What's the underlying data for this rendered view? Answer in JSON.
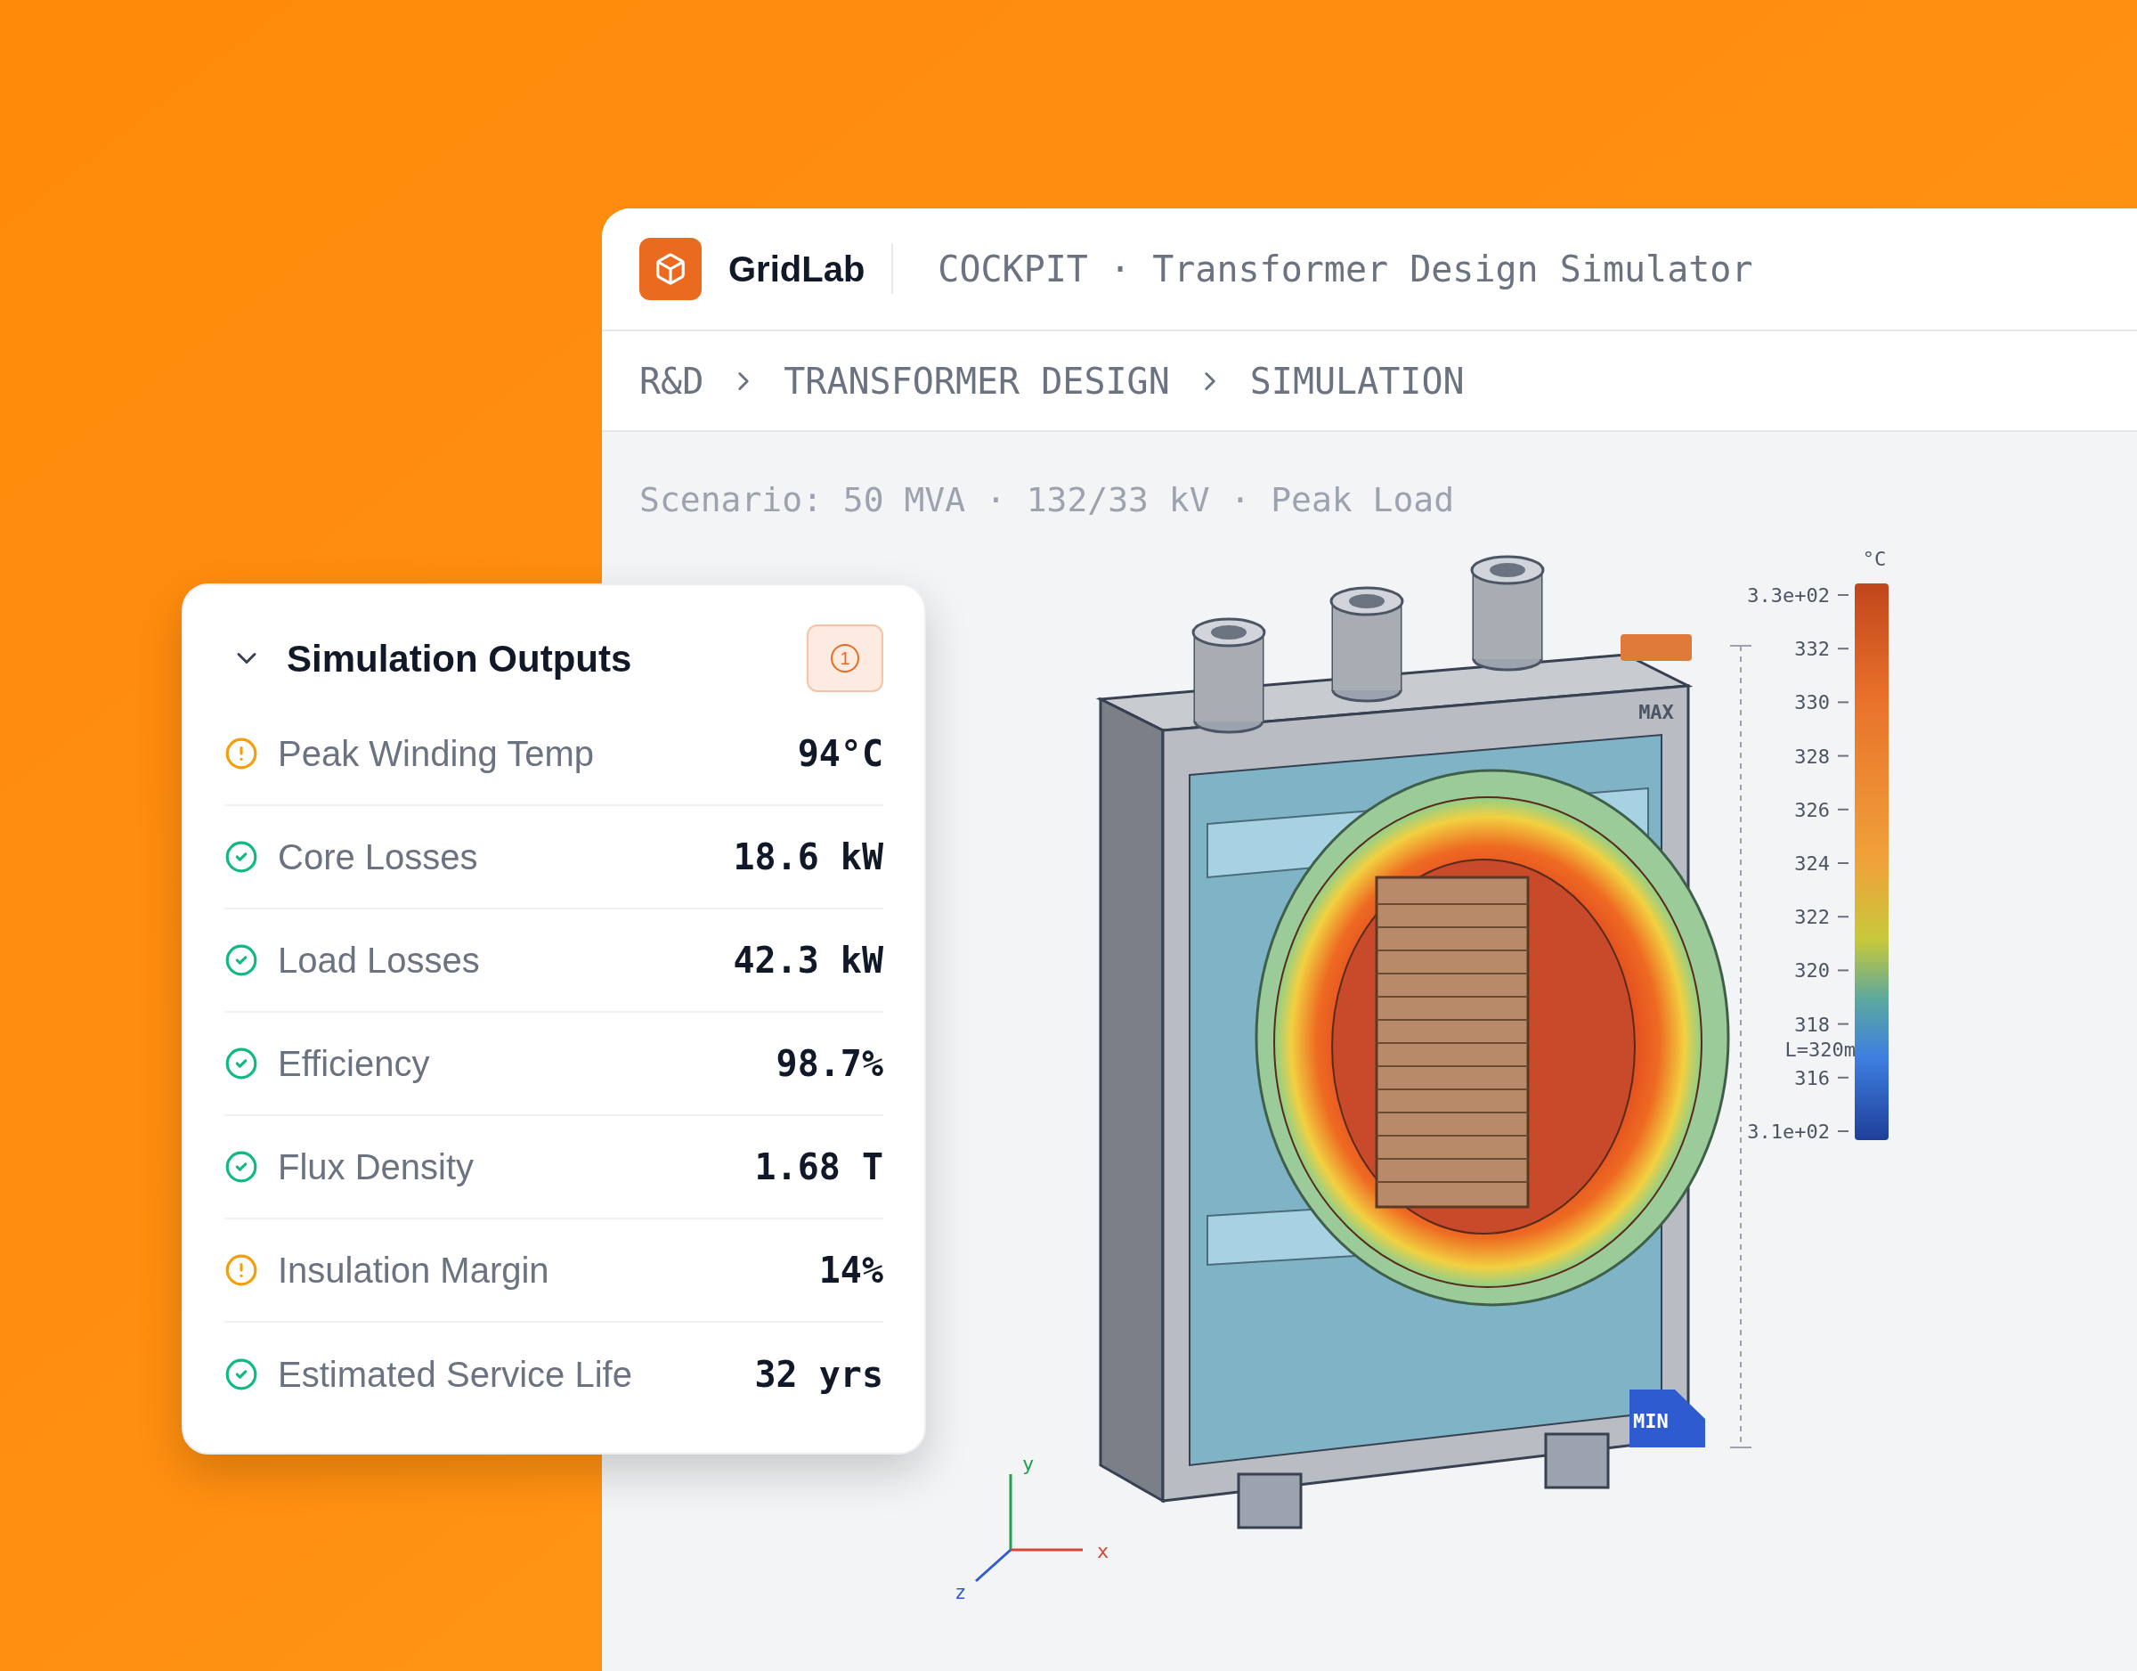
{
  "brand": {
    "name": "GridLab"
  },
  "app_title": "COCKPIT · Transformer Design Simulator",
  "breadcrumb": [
    {
      "label": "R&D"
    },
    {
      "label": "TRANSFORMER DESIGN"
    },
    {
      "label": "SIMULATION"
    }
  ],
  "scenario": "Scenario: 50 MVA · 132/33 kV · Peak Load",
  "viewport": {
    "unit": "°C",
    "colorbar_ticks": [
      "3.3e+02",
      "332",
      "330",
      "328",
      "326",
      "324",
      "322",
      "320",
      "318",
      "316",
      "3.1e+02"
    ],
    "scale_label": "L=320m",
    "max_label": "MAX",
    "min_label": "MIN",
    "axes": {
      "x": "x",
      "y": "y",
      "z": "z"
    }
  },
  "panel": {
    "title": "Simulation Outputs",
    "expanded": true,
    "alert_count": "1",
    "rows": [
      {
        "label": "Peak Winding Temp",
        "value": "94°C",
        "kind": "warning"
      },
      {
        "label": "Core Losses",
        "value": "18.6 kW",
        "kind": "ok"
      },
      {
        "label": "Load Losses",
        "value": "42.3 kW",
        "kind": "ok"
      },
      {
        "label": "Efficiency",
        "value": "98.7%",
        "kind": "ok"
      },
      {
        "label": "Flux Density",
        "value": "1.68 T",
        "kind": "ok"
      },
      {
        "label": "Insulation Margin",
        "value": "14%",
        "kind": "warning"
      },
      {
        "label": "Estimated Service Life",
        "value": "32 yrs",
        "kind": "ok"
      }
    ]
  }
}
